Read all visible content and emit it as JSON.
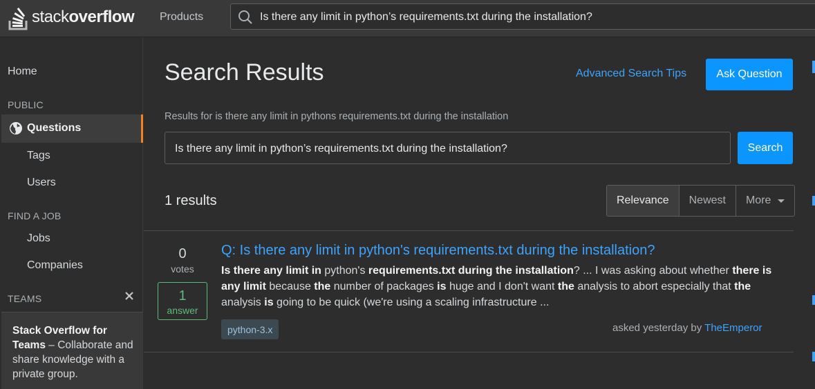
{
  "header": {
    "logo_text_light": "stack",
    "logo_text_bold": "overflow",
    "products_label": "Products",
    "search_value": "Is there any limit in python’s requirements.txt during the installation?"
  },
  "sidebar": {
    "home": "Home",
    "public_section": "PUBLIC",
    "questions": "Questions",
    "tags": "Tags",
    "users": "Users",
    "job_section": "FIND A JOB",
    "jobs": "Jobs",
    "companies": "Companies",
    "teams_section": "TEAMS",
    "teams_title_1": "Stack Overflow for",
    "teams_title_2": "Teams",
    "teams_desc": "– Collaborate and share knowledge with a private group."
  },
  "main": {
    "title": "Search Results",
    "advanced_tips": "Advanced Search Tips",
    "ask_button": "Ask Question",
    "results_for": "Results for is there any limit in pythons requirements.txt during the installation",
    "search_value": "Is there any limit in python’s requirements.txt during the installation?",
    "search_button": "Search",
    "result_count": "1 results",
    "filters": [
      "Relevance",
      "Newest",
      "More"
    ]
  },
  "result": {
    "votes": "0",
    "votes_label": "votes",
    "answers": "1",
    "answers_label": "answer",
    "title": "Q: Is there any limit in python's requirements.txt during the installation?",
    "excerpt_segments": [
      {
        "t": "Is there any limit in",
        "b": true
      },
      {
        "t": " python's ",
        "b": false
      },
      {
        "t": "requirements.txt during the installation",
        "b": true
      },
      {
        "t": "? ... I was asking about whether ",
        "b": false
      },
      {
        "t": "there is any limit",
        "b": true
      },
      {
        "t": " because ",
        "b": false
      },
      {
        "t": "the",
        "b": true
      },
      {
        "t": " number of packages ",
        "b": false
      },
      {
        "t": "is",
        "b": true
      },
      {
        "t": " huge and I don't want ",
        "b": false
      },
      {
        "t": "the",
        "b": true
      },
      {
        "t": " analysis to abort especially that ",
        "b": false
      },
      {
        "t": "the",
        "b": true
      },
      {
        "t": " analysis ",
        "b": false
      },
      {
        "t": "is",
        "b": true
      },
      {
        "t": " going to be quick (we're using a scaling infrastructure ...",
        "b": false
      }
    ],
    "tag": "python-3.x",
    "asked_text": "asked yesterday by",
    "author": "TheEmperor"
  },
  "colors": {
    "accent": "#f48225",
    "link": "#3ca4ff",
    "primary_button": "#0a95ff",
    "answered_green": "#5eba7d"
  }
}
